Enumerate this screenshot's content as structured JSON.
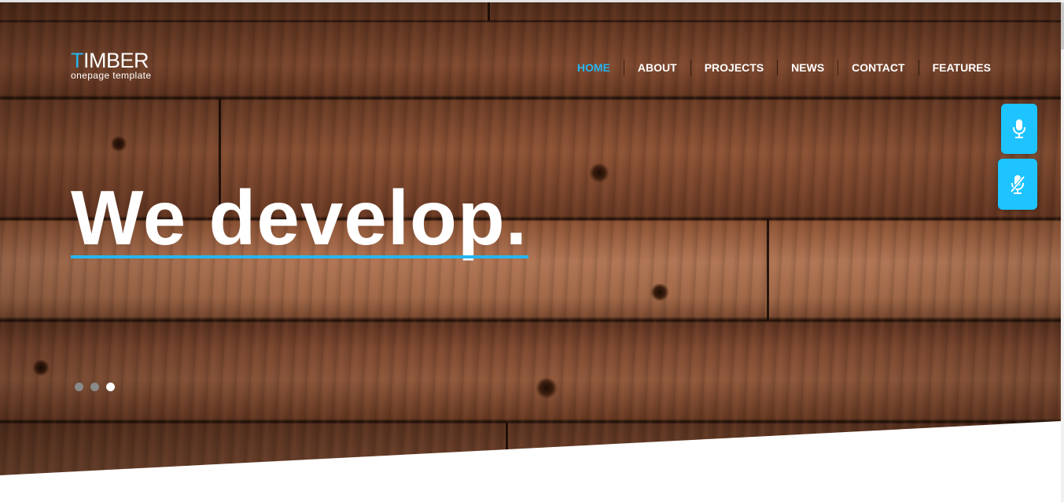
{
  "brand": {
    "first_letter": "T",
    "rest": "IMBER",
    "tagline": "onepage template",
    "accent": "#26b6f0"
  },
  "nav": {
    "items": [
      {
        "label": "HOME",
        "active": true
      },
      {
        "label": "ABOUT",
        "active": false
      },
      {
        "label": "PROJECTS",
        "active": false
      },
      {
        "label": "NEWS",
        "active": false
      },
      {
        "label": "CONTACT",
        "active": false
      },
      {
        "label": "FEATURES",
        "active": false
      }
    ]
  },
  "hero": {
    "headline": "We develop.",
    "slides_total": 3,
    "active_slide": 3
  },
  "voice_controls": {
    "start_icon": "microphone-icon",
    "stop_icon": "microphone-off-icon",
    "button_color": "#1ec4ff"
  }
}
